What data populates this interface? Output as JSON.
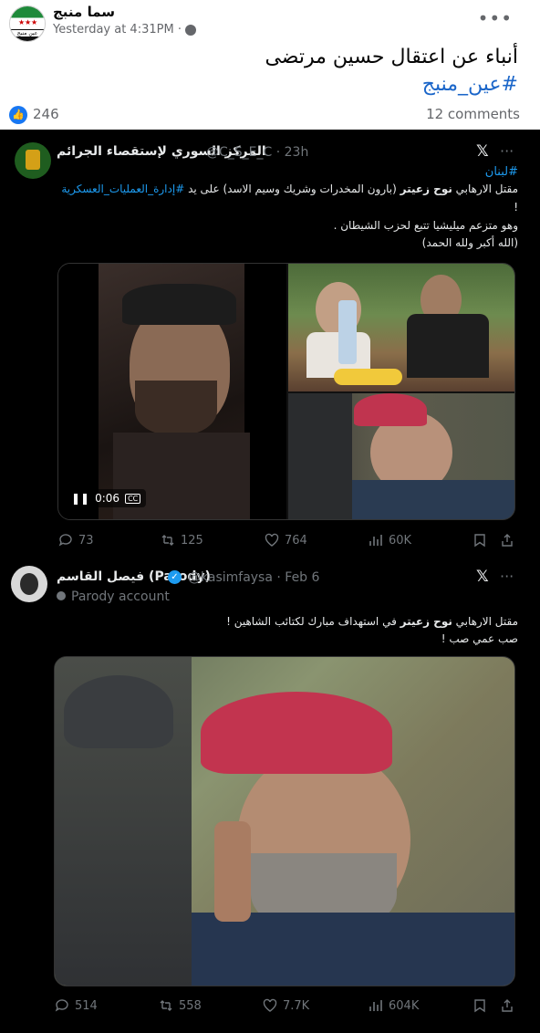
{
  "post": {
    "page_name": "سما منبج",
    "avatar_label": "عين منبج",
    "time": "Yesterday at 4:31PM · ",
    "text": "أنباء عن اعتقال حسين مرتضى",
    "hashtag": "#عين_منبج",
    "likes": "246",
    "comments": "12 comments"
  },
  "tweet1": {
    "name": "المركز السوري لإستقصاء الجرائم",
    "handle": "@C_S_E_C · 23h",
    "line1": "#لبنان",
    "line2_a": "مقتل الارهابي ",
    "line2_bold": "نوح زعيتر",
    "line2_b": " (بارون المخدرات وشريك وسيم الاسد)  على يد ",
    "line2_tag": "#إدارة_العمليات_العسكرية",
    "line3": "!",
    "line4": "وهو متزعم ميليشيا تتبع لحزب الشيطان .",
    "line5": "(الله أكبر ولله الحمد)",
    "video_time": "0:06",
    "cc": "CC",
    "replies": "73",
    "reposts": "125",
    "likes": "764",
    "views": "60K"
  },
  "tweet2": {
    "name": "فيصل القاسم (Parody)",
    "handle": "@kasimfaysa · Feb 6",
    "parody": "Parody account",
    "line1_a": "مقتل الارهابي ",
    "line1_bold": "نوح زعيتر",
    "line1_b": " في استهداف مبارك لكتائب الشاهين !",
    "line2": "صب عمي صب !",
    "replies": "514",
    "reposts": "558",
    "likes": "7.7K",
    "views": "604K"
  },
  "colors": {
    "fb_blue": "#1877f2",
    "link_blue": "#1b66c9",
    "x_blue": "#1d9bf0",
    "x_bg": "#000000"
  }
}
